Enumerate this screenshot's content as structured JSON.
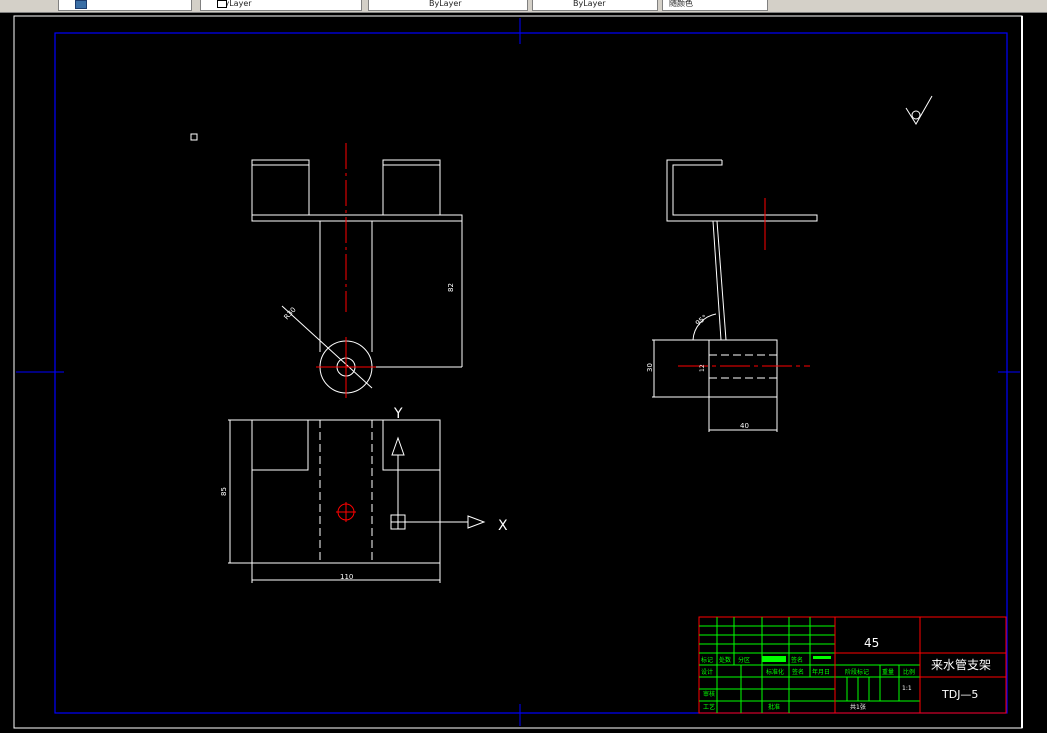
{
  "toolbar": {
    "tabs": [
      {
        "name": "layer-tab",
        "text": ""
      },
      {
        "name": "color-tab",
        "text": "ByLayer"
      },
      {
        "name": "linetype-tab",
        "text": "ByLayer"
      },
      {
        "name": "lineweight-tab",
        "text": "ByLayer"
      },
      {
        "name": "plotstyle-tab",
        "text": "随颜色"
      }
    ]
  },
  "drawing": {
    "dimensions": {
      "height_right": "82",
      "radius_label": "R30",
      "angle_label": "95°",
      "side_height": "30",
      "hole_dia": "12",
      "side_width": "40",
      "plan_height": "85",
      "plan_width": "110"
    },
    "axis": {
      "x": "X",
      "y": "Y"
    }
  },
  "title_block": {
    "material": "45",
    "part_name": "来水管支架",
    "drawing_no": "TDJ—5",
    "scale": "1:1",
    "sheet": "共1张",
    "labels": {
      "mark": "标记",
      "count": "处数",
      "zone": "分区",
      "change_doc": "更改文件号",
      "sign": "签名",
      "date": "年月日",
      "design": "设计",
      "standard": "标准化",
      "stage_mark": "阶段标记",
      "weight": "重量",
      "ratio": "比例",
      "review": "审核",
      "process": "工艺",
      "approve": "批准"
    }
  },
  "colors": {
    "bg": "#000000",
    "frame": "#0000ff",
    "geom": "#ffffff",
    "center": "#ff0000",
    "table_green": "#00ff00",
    "table_red": "#ff0000"
  }
}
